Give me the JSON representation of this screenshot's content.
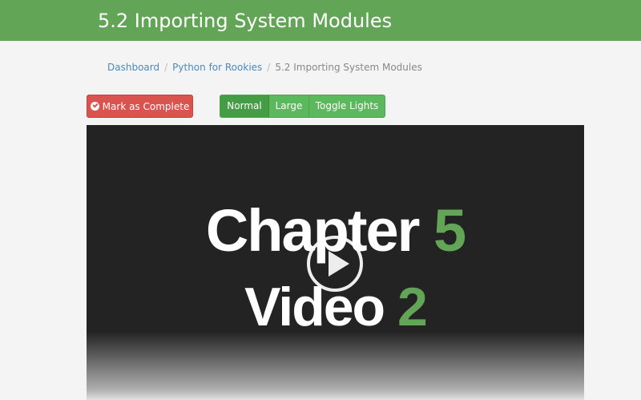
{
  "header": {
    "title": "5.2 Importing System Modules"
  },
  "breadcrumb": {
    "items": [
      "Dashboard",
      "Python for Rookies"
    ],
    "current": "5.2 Importing System Modules",
    "separator": "/"
  },
  "actions": {
    "complete_label": "Mark as Complete",
    "complete_icon": "check-circle-icon"
  },
  "view_controls": {
    "normal_label": "Normal",
    "large_label": "Large",
    "lights_label": "Toggle Lights",
    "selected": "Normal"
  },
  "video": {
    "line1_text": "Chapter",
    "line1_number": "5",
    "line2_text": "Video",
    "line2_number": "2",
    "play_icon": "play-icon"
  },
  "colors": {
    "brand_green": "#62a556",
    "button_green": "#5cb85c",
    "danger_red": "#d9534f",
    "video_bg": "#232323"
  }
}
